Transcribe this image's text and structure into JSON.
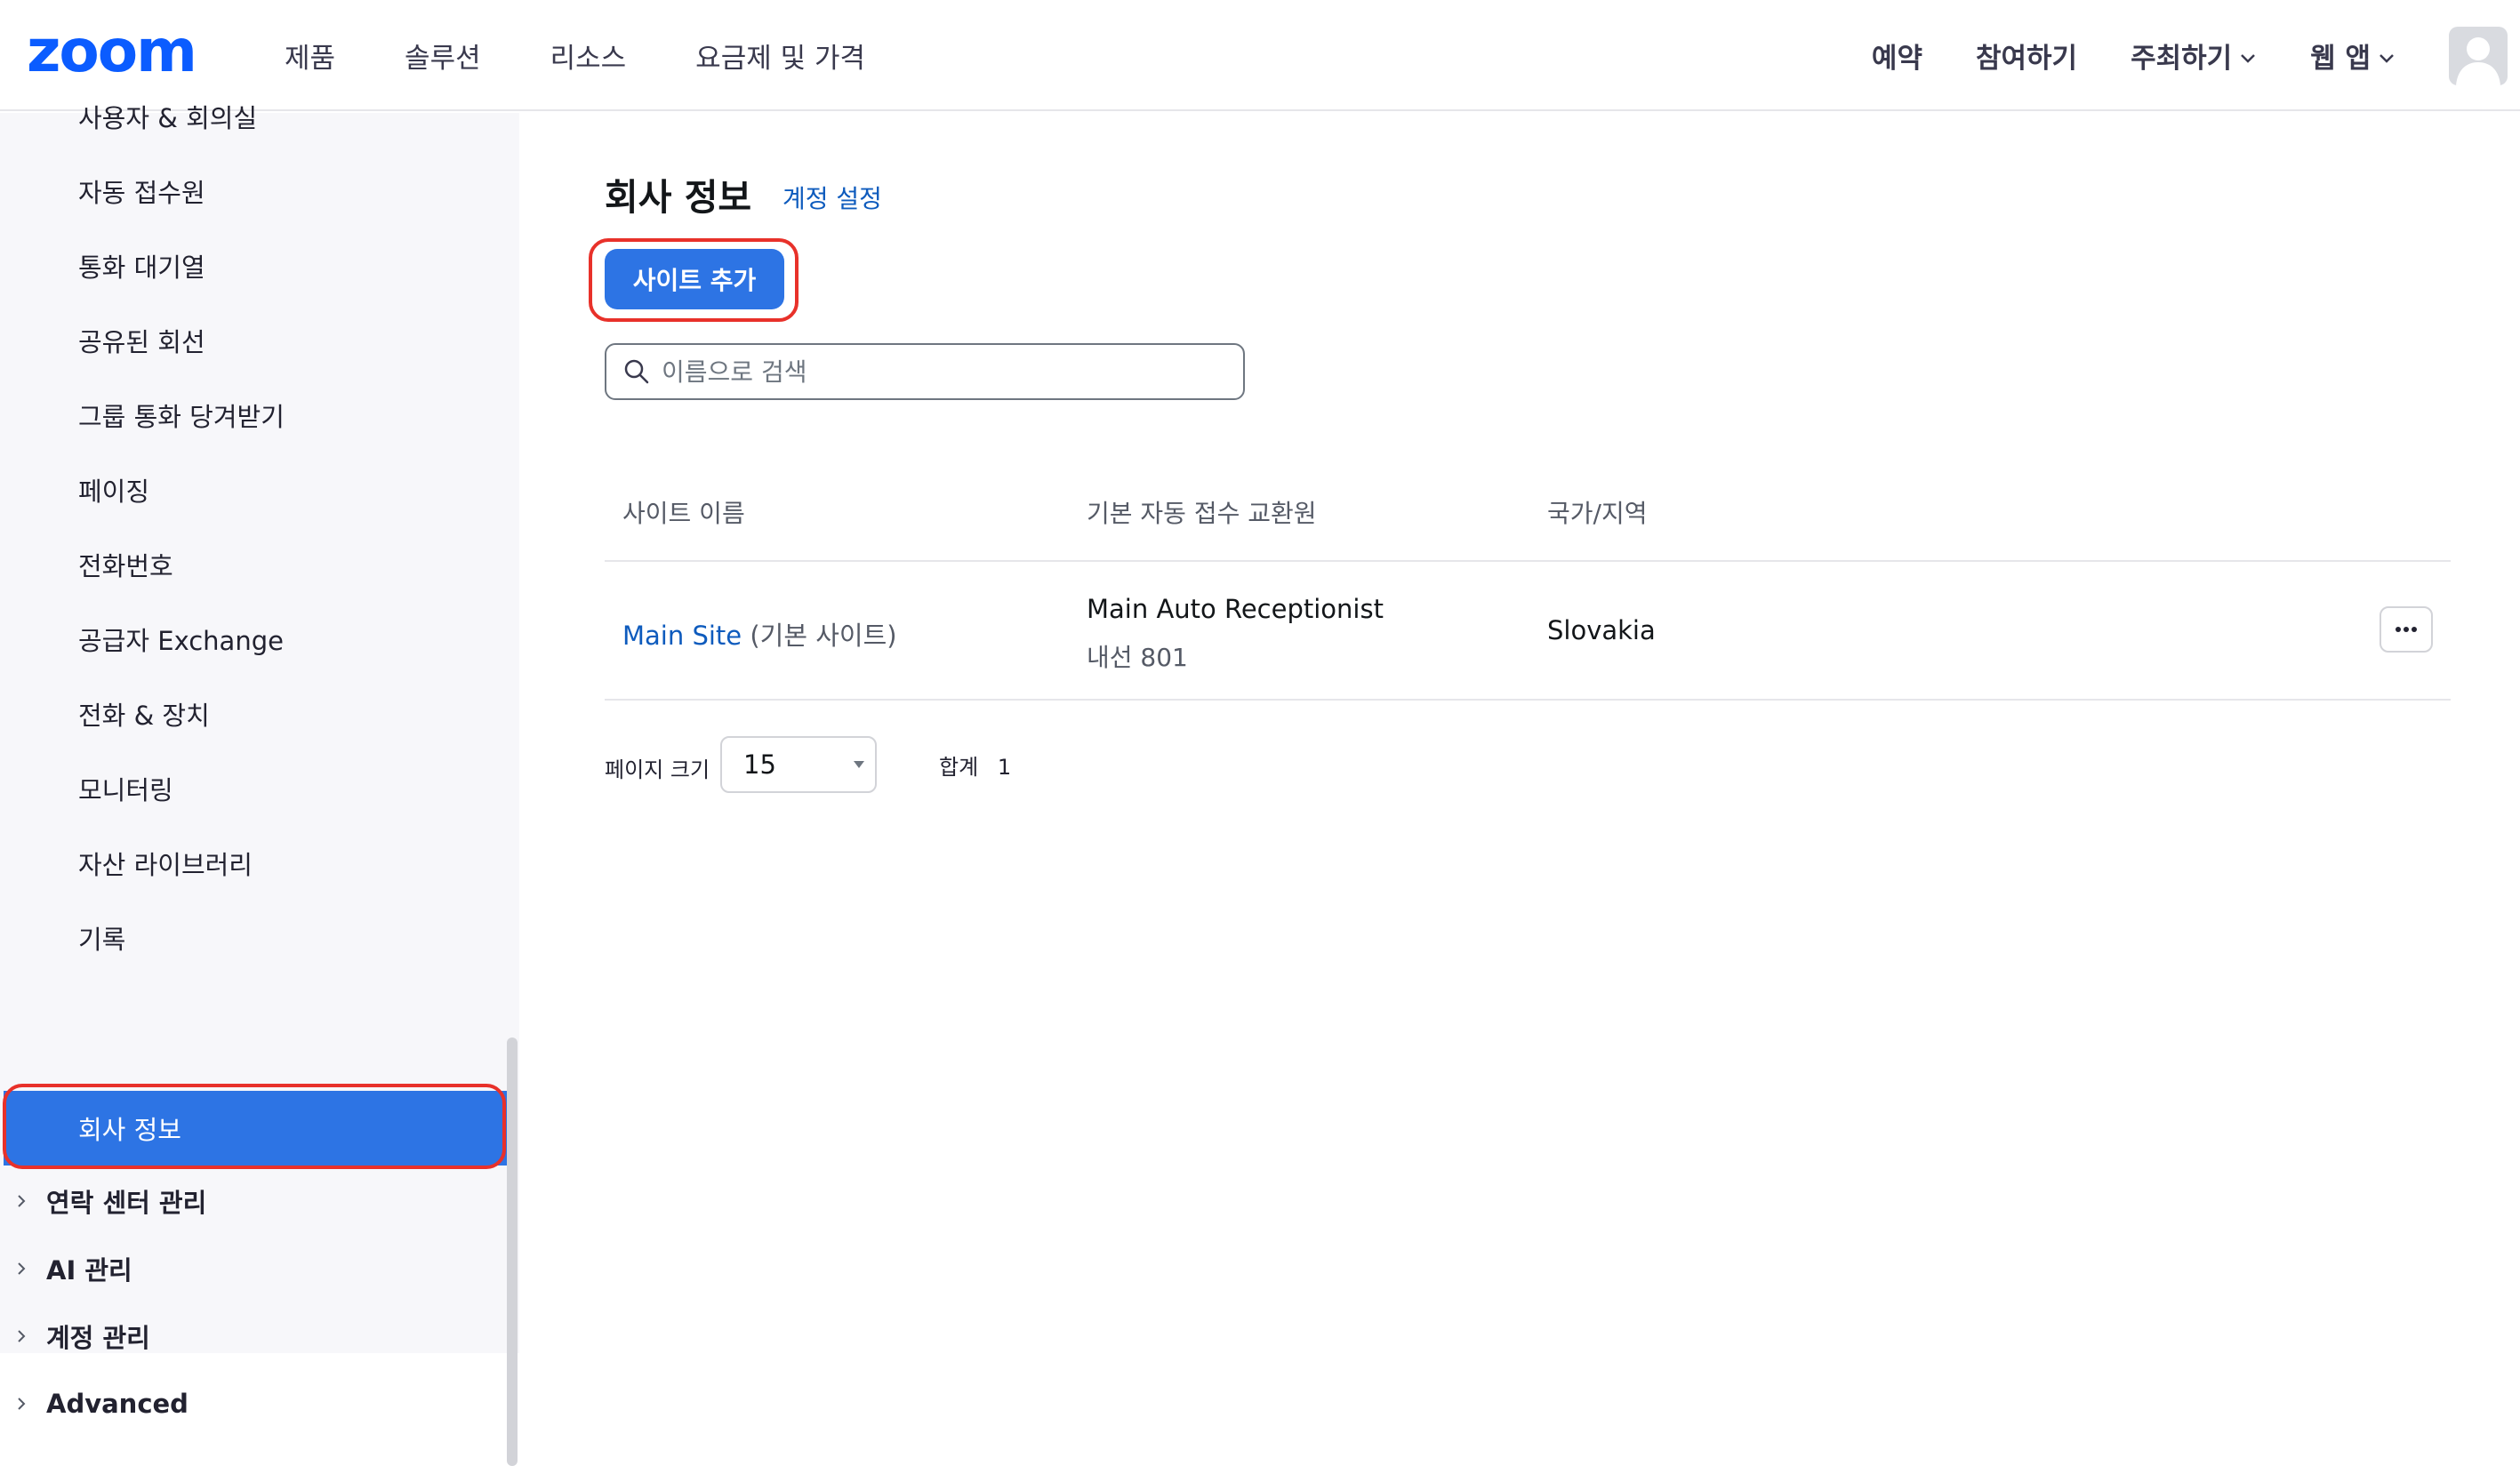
{
  "brand": {
    "logo_text": "zoom",
    "logo_color": "#0b5cff"
  },
  "nav": {
    "left": [
      "제품",
      "솔루션",
      "리소스",
      "요금제 및 가격"
    ],
    "right": [
      {
        "label": "예약",
        "dropdown": false
      },
      {
        "label": "참여하기",
        "dropdown": false
      },
      {
        "label": "주최하기",
        "dropdown": true
      },
      {
        "label": "웹 앱",
        "dropdown": true
      }
    ],
    "avatar_icon": "user-avatar-icon"
  },
  "sidebar": {
    "items": [
      "사용자 & 회의실",
      "자동 접수원",
      "통화 대기열",
      "공유된 회선",
      "그룹 통화 당겨받기",
      "페이징",
      "전화번호",
      "공급자 Exchange",
      "전화 & 장치",
      "모니터링",
      "자산 라이브러리",
      "기록",
      "회사 정보"
    ],
    "active_item": "회사 정보",
    "groups": [
      "연락 센터 관리",
      "AI 관리",
      "계정 관리",
      "Advanced"
    ]
  },
  "main": {
    "title": "회사 정보",
    "account_settings_link": "계정 설정",
    "add_site_button": "사이트 추가",
    "search_placeholder": "이름으로 검색",
    "table": {
      "headers": [
        "사이트 이름",
        "기본 자동 접수 교환원",
        "국가/지역"
      ],
      "rows": [
        {
          "site_name": "Main Site",
          "site_tag": "(기본 사이트)",
          "auto_receptionist": "Main Auto Receptionist",
          "extension": "내선 801",
          "country": "Slovakia",
          "actions_icon": "more-horizontal-icon"
        }
      ]
    },
    "pagination": {
      "page_size_label": "페이지 크기",
      "page_size_value": "15",
      "total_label": "합계",
      "total_value": "1"
    }
  },
  "colors": {
    "accent": "#2d74e4",
    "link": "#0e5bbd",
    "highlight_outline": "#e8312a"
  }
}
